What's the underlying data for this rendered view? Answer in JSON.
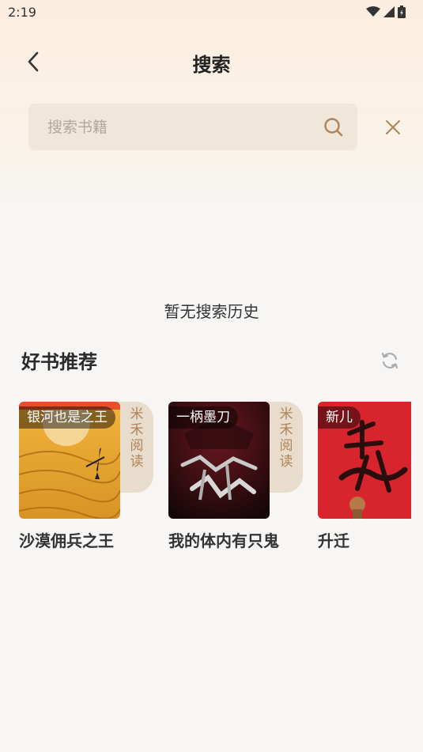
{
  "status_bar": {
    "time": "2:19"
  },
  "header": {
    "title": "搜索"
  },
  "search": {
    "placeholder": "搜索书籍",
    "value": ""
  },
  "history": {
    "empty_text": "暂无搜索历史"
  },
  "recommend": {
    "title": "好书推荐",
    "books": [
      {
        "name": "沙漠佣兵之王",
        "author": "银河也是之王",
        "tag": [
          "米",
          "禾",
          "阅",
          "读"
        ]
      },
      {
        "name": "我的体内有只鬼",
        "author": "一柄墨刀",
        "tag": [
          "米",
          "禾",
          "阅",
          "读"
        ]
      },
      {
        "name": "升迁",
        "author": "新儿"
      }
    ]
  },
  "colors": {
    "accent": "#b08456",
    "search_bg": "#f0e6da",
    "tag_bg": "#e8dccd"
  }
}
